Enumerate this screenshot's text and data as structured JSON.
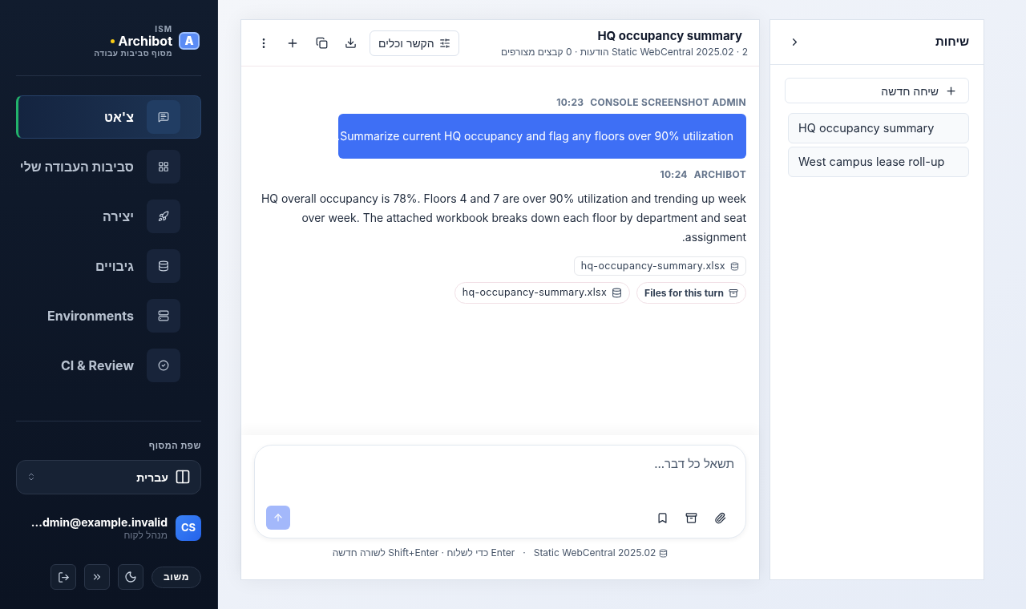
{
  "brand": {
    "logo_letter": "A",
    "tag": "ISM",
    "name": "Archibot",
    "subtitle": "מסוף סביבות עבודה"
  },
  "nav": [
    {
      "label": "צ'אט",
      "selected": true
    },
    {
      "label": "סביבות העבודה שלי",
      "selected": false
    },
    {
      "label": "יצירה",
      "selected": false
    },
    {
      "label": "גיבויים",
      "selected": false
    },
    {
      "label": "Environments",
      "selected": false
    },
    {
      "label": "CI & Review",
      "selected": false
    }
  ],
  "language": {
    "label": "שפת המסוף",
    "value": "עברית"
  },
  "user": {
    "initials": "CS",
    "email": "...dmin@example.invalid",
    "role": "מנהל לקוח"
  },
  "feedback_button": "משוב",
  "chat": {
    "title": "HQ occupancy summary",
    "subtitle": "Static WebCentral 2025.02 · 2 הודעות · 0 קבצים מצורפים",
    "context_button": "הקשר וכלים",
    "messages": [
      {
        "kind": "user",
        "author": "CONSOLE SCREENSHOT ADMIN",
        "time": "10:23",
        "text": "Summarize current HQ occupancy and flag any floors over 90% utilization."
      },
      {
        "kind": "assistant",
        "author": "ARCHIBOT",
        "time": "10:24",
        "text": "HQ overall occupancy is 78%. Floors 4 and 7 are over 90% utilization and trending up week over week. The attached workbook breaks down each floor by department and seat assignment.",
        "attachments": [
          "hq-occupancy-summary.xlsx"
        ]
      }
    ],
    "turn_files": {
      "label": "Files for this turn",
      "files": [
        "hq-occupancy-summary.xlsx"
      ]
    },
    "composer": {
      "placeholder": "תשאל כל דבר..."
    },
    "footer": {
      "version": "Static WebCentral 2025.02",
      "separator": "·",
      "hint": "Enter כדי לשלוח · Shift+Enter לשורה חדשה"
    }
  },
  "conversations": {
    "title": "שיחות",
    "new_button": "שיחה חדשה",
    "items": [
      {
        "title": "HQ occupancy summary",
        "selected": false
      },
      {
        "title": "West campus lease roll-up",
        "selected": false
      }
    ]
  }
}
